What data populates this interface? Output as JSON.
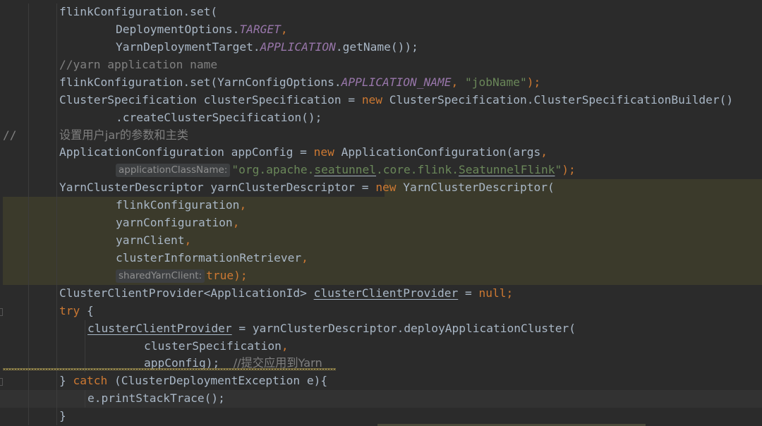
{
  "editor": {
    "lines": [
      {
        "n": "l01",
        "tokens": [
          "flinkConfiguration.set("
        ]
      },
      {
        "n": "l02",
        "tokens": [
          "DeploymentOptions.",
          "TARGET",
          ","
        ]
      },
      {
        "n": "l03",
        "tokens": [
          "YarnDeploymentTarget.",
          "APPLICATION",
          ".getName());"
        ]
      },
      {
        "n": "l04",
        "tokens": [
          "//yarn application name"
        ]
      },
      {
        "n": "l05",
        "tokens": [
          "flinkConfiguration.set(YarnConfigOptions.",
          "APPLICATION_NAME",
          ", ",
          "\"jobName\"",
          ");"
        ]
      },
      {
        "n": "l06",
        "tokens": [
          "ClusterSpecification clusterSpecification = ",
          "new",
          " ClusterSpecification.ClusterSpecificationBuilder()"
        ]
      },
      {
        "n": "l07",
        "tokens": [
          ".createClusterSpecification();"
        ]
      },
      {
        "n": "l08",
        "tokens": [
          "//",
          "设置用户jar的参数和主类"
        ]
      },
      {
        "n": "l09",
        "tokens": [
          "ApplicationConfiguration appConfig = ",
          "new",
          " ApplicationConfiguration(args",
          ","
        ]
      },
      {
        "n": "l10",
        "tokens": [
          "applicationClassName:",
          "\"org.apache.",
          "seatunnel",
          ".core.flink.",
          "SeatunnelFlink",
          "\"",
          ");"
        ]
      },
      {
        "n": "l11",
        "tokens": [
          "YarnClusterDescriptor yarnClusterDescriptor = ",
          "new",
          " YarnClusterDescriptor("
        ]
      },
      {
        "n": "l12",
        "tokens": [
          "flinkConfiguration",
          ","
        ]
      },
      {
        "n": "l13",
        "tokens": [
          "yarnConfiguration",
          ","
        ]
      },
      {
        "n": "l14",
        "tokens": [
          "yarnClient",
          ","
        ]
      },
      {
        "n": "l15",
        "tokens": [
          "clusterInformationRetriever",
          ","
        ]
      },
      {
        "n": "l16",
        "tokens": [
          "sharedYarnClient:",
          "true",
          ");"
        ]
      },
      {
        "n": "l17",
        "tokens": [
          "ClusterClientProvider<ApplicationId> ",
          "clusterClientProvider",
          " = ",
          "null",
          ";"
        ]
      },
      {
        "n": "l18",
        "tokens": [
          "try",
          " {"
        ]
      },
      {
        "n": "l19",
        "tokens": [
          "clusterClientProvider",
          " = yarnClusterDescriptor.deployApplicationCluster("
        ]
      },
      {
        "n": "l20",
        "tokens": [
          "clusterSpecification",
          ","
        ]
      },
      {
        "n": "l21",
        "tokens": [
          "appConfig);  ",
          "//提交应用到Yarn"
        ]
      },
      {
        "n": "l22",
        "tokens": [
          "} ",
          "catch",
          " (ClusterDeploymentException e){"
        ]
      },
      {
        "n": "l23",
        "tokens": [
          "e.printStackTrace();"
        ]
      },
      {
        "n": "l24",
        "tokens": [
          "}"
        ]
      }
    ]
  },
  "colors": {
    "background": "#2b2b2b",
    "keyword": "#cc7832",
    "string": "#6a8759",
    "comment": "#808080",
    "field": "#9876aa",
    "text": "#a9b7c6",
    "highlight": "#3b3a2b"
  }
}
